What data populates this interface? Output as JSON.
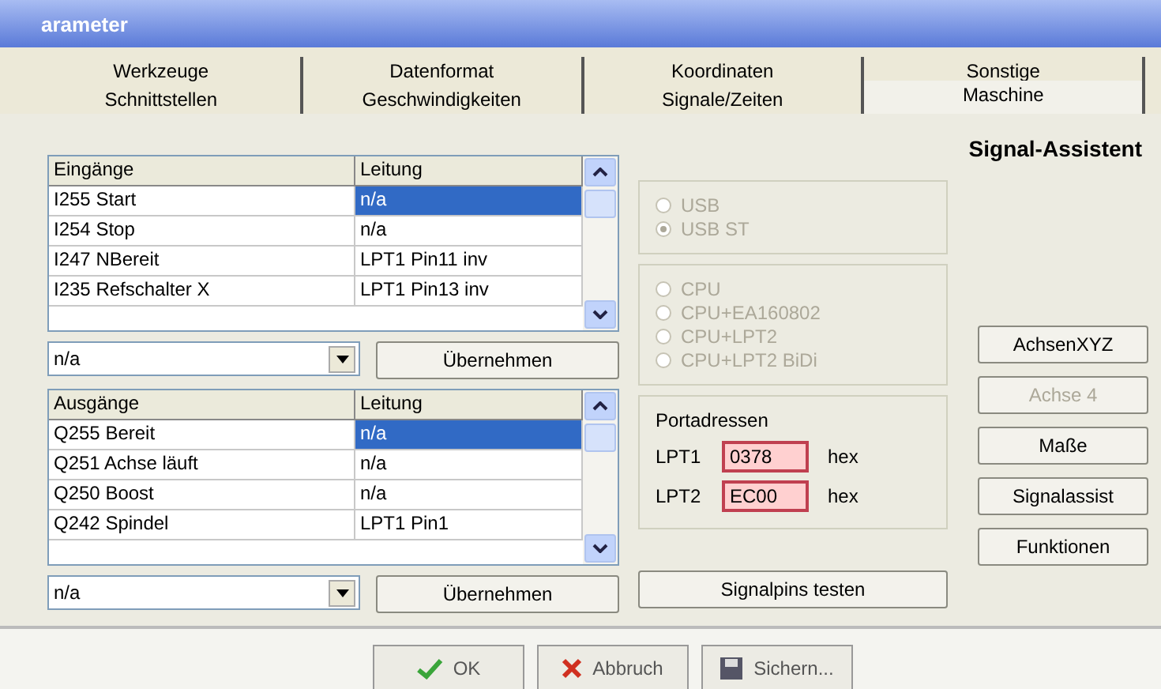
{
  "window": {
    "title": "arameter"
  },
  "tab_rows": [
    [
      {
        "label": "Werkzeuge",
        "selected": false
      },
      {
        "label": "Datenformat",
        "selected": false
      },
      {
        "label": "Koordinaten",
        "selected": false
      },
      {
        "label": "Sonstige",
        "selected": false
      }
    ],
    [
      {
        "label": "Schnittstellen",
        "selected": false
      },
      {
        "label": "Geschwindigkeiten",
        "selected": false
      },
      {
        "label": "Signale/Zeiten",
        "selected": false
      },
      {
        "label": "Maschine",
        "selected": true
      }
    ]
  ],
  "heading": "Signal-Assistent",
  "tables": [
    {
      "columns": [
        "Eingänge",
        "Leitung"
      ],
      "rows": [
        {
          "cells": [
            "I255 Start",
            "n/a"
          ],
          "selected": true
        },
        {
          "cells": [
            "I254 Stop",
            "n/a"
          ],
          "selected": false
        },
        {
          "cells": [
            "I247 NBereit",
            "LPT1 Pin11 inv"
          ],
          "selected": false
        },
        {
          "cells": [
            "I235 Refschalter X",
            "LPT1 Pin13 inv"
          ],
          "selected": false
        }
      ],
      "combo": {
        "value": "n/a"
      },
      "apply_button": "Übernehmen"
    },
    {
      "columns": [
        "Ausgänge",
        "Leitung"
      ],
      "rows": [
        {
          "cells": [
            "Q255 Bereit",
            "n/a"
          ],
          "selected": true
        },
        {
          "cells": [
            "Q251 Achse läuft",
            "n/a"
          ],
          "selected": false
        },
        {
          "cells": [
            "Q250 Boost",
            "n/a"
          ],
          "selected": false
        },
        {
          "cells": [
            "Q242 Spindel",
            "LPT1 Pin1"
          ],
          "selected": false
        }
      ],
      "combo": {
        "value": "n/a"
      },
      "apply_button": "Übernehmen"
    }
  ],
  "radio_groups": [
    [
      {
        "label": "USB",
        "selected": false,
        "disabled": true
      },
      {
        "label": "USB ST",
        "selected": true,
        "disabled": true
      }
    ],
    [
      {
        "label": "CPU",
        "selected": false,
        "disabled": true
      },
      {
        "label": "CPU+EA160802",
        "selected": false,
        "disabled": true
      },
      {
        "label": "CPU+LPT2",
        "selected": false,
        "disabled": true
      },
      {
        "label": "CPU+LPT2 BiDi",
        "selected": false,
        "disabled": true
      }
    ]
  ],
  "port_addresses": {
    "title": "Portadressen",
    "rows": [
      {
        "label": "LPT1",
        "value": "0378",
        "unit": "hex"
      },
      {
        "label": "LPT2",
        "value": "EC00",
        "unit": "hex"
      }
    ]
  },
  "test_button": "Signalpins testen",
  "side_buttons": [
    {
      "label": "AchsenXYZ",
      "disabled": false
    },
    {
      "label": "Achse 4",
      "disabled": true
    },
    {
      "label": "Maße",
      "disabled": false
    },
    {
      "label": "Signalassist",
      "disabled": false
    },
    {
      "label": "Funktionen",
      "disabled": false
    }
  ],
  "footer_buttons": [
    {
      "label": "OK",
      "kind": "check"
    },
    {
      "label": "Abbruch",
      "kind": "cross"
    },
    {
      "label": "Sichern...",
      "kind": "disk"
    }
  ]
}
